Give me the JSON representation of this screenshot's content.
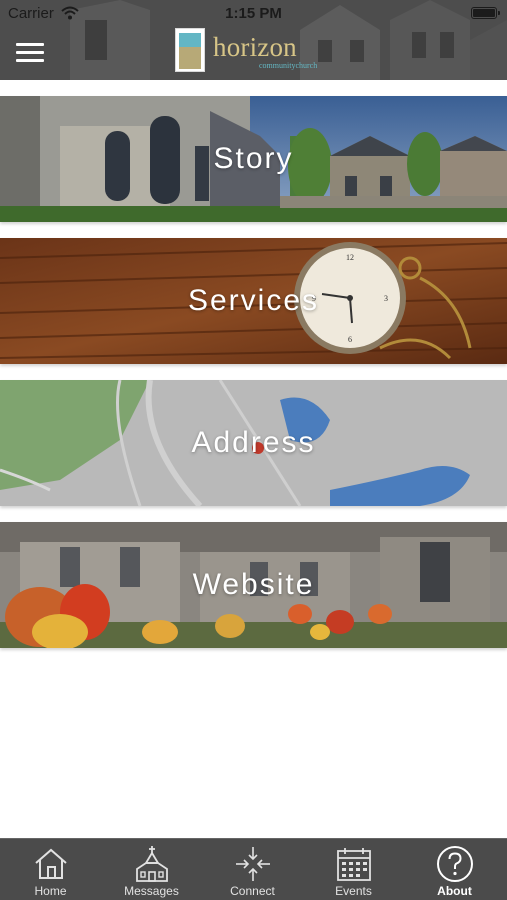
{
  "status_bar": {
    "carrier": "Carrier",
    "time": "1:15 PM"
  },
  "header": {
    "menu_icon": "hamburger-menu-icon",
    "logo": {
      "word": "horizon",
      "subtitle": "communitychurch",
      "colors": {
        "word": "#d7c587",
        "subtitle": "#64b8c4",
        "sky": "#63b6c4",
        "land": "#b7a977"
      }
    }
  },
  "cards": [
    {
      "label": "Story",
      "background": "church-building-photo"
    },
    {
      "label": "Services",
      "background": "pocket-watch-on-wood-photo"
    },
    {
      "label": "Address",
      "background": "map-view"
    },
    {
      "label": "Website",
      "background": "tulips-and-church-photo"
    }
  ],
  "tabbar": {
    "background": "#4b4b4b",
    "tabs": [
      {
        "label": "Home",
        "icon": "house-icon",
        "active": false
      },
      {
        "label": "Messages",
        "icon": "church-icon",
        "active": false
      },
      {
        "label": "Connect",
        "icon": "crosshair-arrows-icon",
        "active": false
      },
      {
        "label": "Events",
        "icon": "calendar-icon",
        "active": false
      },
      {
        "label": "About",
        "icon": "question-circle-icon",
        "active": true
      }
    ]
  }
}
